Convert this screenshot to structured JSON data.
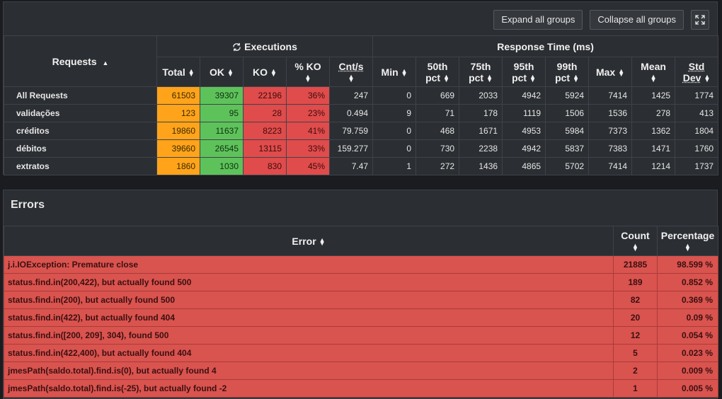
{
  "toolbar": {
    "expand_label": "Expand all groups",
    "collapse_label": "Collapse all groups",
    "fullscreen_icon": "expand-arrows-icon"
  },
  "stats": {
    "requests_label": "Requests",
    "executions_label": "Executions",
    "response_time_label": "Response Time (ms)",
    "columns": [
      "Total",
      "OK",
      "KO",
      "% KO",
      "Cnt/s",
      "Min",
      "50th pct",
      "75th pct",
      "95th pct",
      "99th pct",
      "Max",
      "Mean",
      "Std Dev"
    ],
    "col_lines": {
      "pko": "% KO",
      "p50a": "50th",
      "p50b": "pct",
      "p75a": "75th",
      "p75b": "pct",
      "p95a": "95th",
      "p95b": "pct",
      "p99a": "99th",
      "p99b": "pct",
      "stda": "Std",
      "stdb": "Dev"
    },
    "rows": [
      {
        "name": "All Requests",
        "total": "61503",
        "ok": "39307",
        "ko": "22196",
        "pko": "36%",
        "cnt": "247",
        "min": "0",
        "p50": "669",
        "p75": "2033",
        "p95": "4942",
        "p99": "5924",
        "max": "7414",
        "mean": "1425",
        "std": "1774"
      },
      {
        "name": "validações",
        "total": "123",
        "ok": "95",
        "ko": "28",
        "pko": "23%",
        "cnt": "0.494",
        "min": "9",
        "p50": "71",
        "p75": "178",
        "p95": "1119",
        "p99": "1506",
        "max": "1536",
        "mean": "278",
        "std": "413"
      },
      {
        "name": "créditos",
        "total": "19860",
        "ok": "11637",
        "ko": "8223",
        "pko": "41%",
        "cnt": "79.759",
        "min": "0",
        "p50": "468",
        "p75": "1671",
        "p95": "4953",
        "p99": "5984",
        "max": "7373",
        "mean": "1362",
        "std": "1804"
      },
      {
        "name": "débitos",
        "total": "39660",
        "ok": "26545",
        "ko": "13115",
        "pko": "33%",
        "cnt": "159.277",
        "min": "0",
        "p50": "730",
        "p75": "2238",
        "p95": "4942",
        "p99": "5837",
        "max": "7383",
        "mean": "1471",
        "std": "1760"
      },
      {
        "name": "extratos",
        "total": "1860",
        "ok": "1030",
        "ko": "830",
        "pko": "45%",
        "cnt": "7.47",
        "min": "1",
        "p50": "272",
        "p75": "1436",
        "p95": "4865",
        "p99": "5702",
        "max": "7414",
        "mean": "1214",
        "std": "1737"
      }
    ]
  },
  "errors": {
    "title": "Errors",
    "col_error": "Error",
    "col_count": "Count",
    "col_percentage": "Percentage",
    "rows": [
      {
        "message": "j.i.IOException: Premature close",
        "count": "21885",
        "pct": "98.599 %"
      },
      {
        "message": "status.find.in(200,422), but actually found 500",
        "count": "189",
        "pct": "0.852 %"
      },
      {
        "message": "status.find.in(200), but actually found 500",
        "count": "82",
        "pct": "0.369 %"
      },
      {
        "message": "status.find.in(422), but actually found 404",
        "count": "20",
        "pct": "0.09 %"
      },
      {
        "message": "status.find.in([200, 209], 304), found 500",
        "count": "12",
        "pct": "0.054 %"
      },
      {
        "message": "status.find.in(422,400), but actually found 404",
        "count": "5",
        "pct": "0.023 %"
      },
      {
        "message": "jmesPath(saldo.total).find.is(0), but actually found 4",
        "count": "2",
        "pct": "0.009 %"
      },
      {
        "message": "jmesPath(saldo.total).find.is(-25), but actually found -2",
        "count": "1",
        "pct": "0.005 %"
      }
    ]
  }
}
